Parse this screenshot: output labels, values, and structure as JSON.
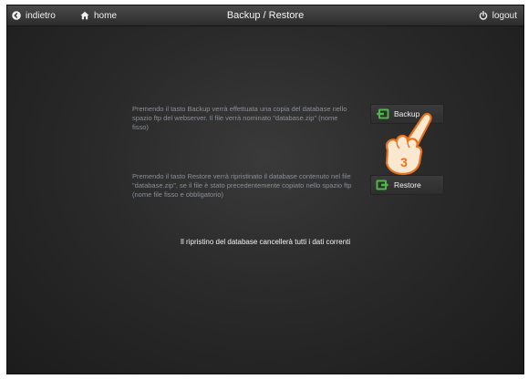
{
  "topbar": {
    "back_label": "indietro",
    "home_label": "home",
    "title": "Backup / Restore",
    "logout_label": "logout"
  },
  "backup": {
    "description": "Premendo il tasto Backup verrà effettuata una copia del database nello spazio ftp del webserver. Il file verrà nominato \"database.zip\" (nome fisso)",
    "button_label": "Backup"
  },
  "restore": {
    "description": "Premendo il tasto Restore verrà ripristinato il database contenuto nel file \"database.zip\", se il file è stato precedentemente copiato nello spazio ftp (nome file fisso e obbligatorio)",
    "button_label": "Restore"
  },
  "warning": "Il ripristino del database cancellerà tutti i dati correnti",
  "tutorial": {
    "step_number": "3"
  },
  "colors": {
    "accent_green": "#4db848",
    "step_orange": "#e8731c",
    "description_text": "#8a8f98"
  },
  "icons": {
    "back": "circle-arrow-left-icon",
    "home": "house-icon",
    "logout": "power-icon",
    "backup": "backup-green-icon",
    "restore": "restore-green-icon",
    "hand": "pointing-hand-icon"
  }
}
